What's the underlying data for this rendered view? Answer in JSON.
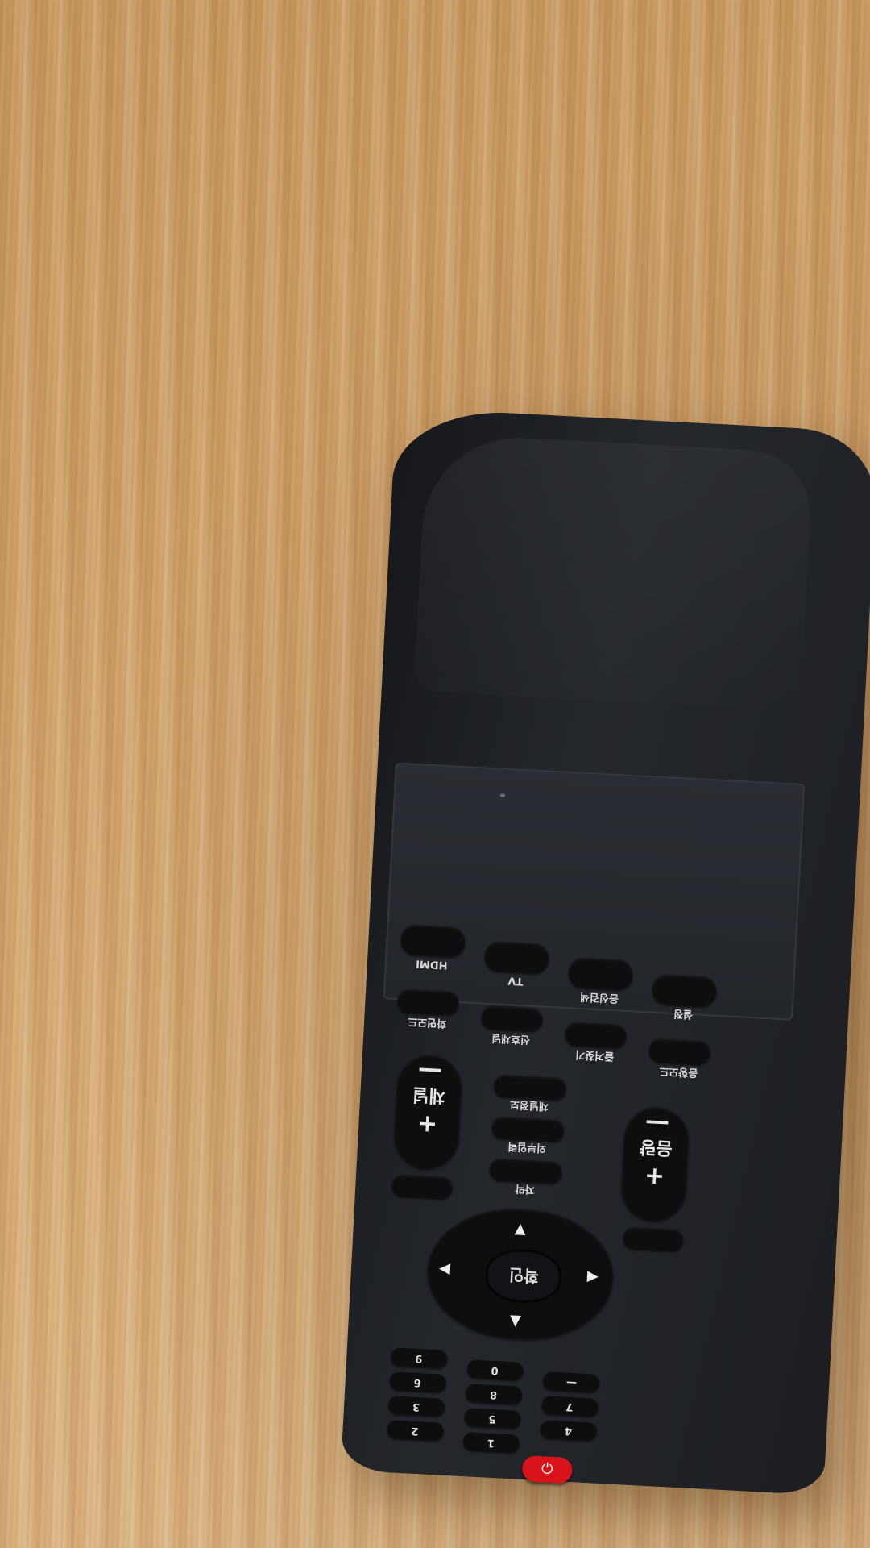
{
  "scene": {
    "surface": "light oak wood tabletop",
    "object": "black TV remote control, upside down"
  },
  "remote": {
    "source_buttons": [
      "HDMI",
      "TV",
      "음성검색",
      "설정"
    ],
    "row2": [
      "화면모드",
      "선호채널",
      "즐겨찾기",
      "음향모드"
    ],
    "channel_label": "채널",
    "volume_label": "음량",
    "middle_keys": [
      "채널정보",
      "외부입력",
      "자막"
    ],
    "ok_label": "확인",
    "minus": "—",
    "plus": "+",
    "up_arrow": "▲",
    "down_arrow": "▼",
    "left_arrow": "◀",
    "right_arrow": "▶",
    "numbers": [
      "1",
      "2",
      "3",
      "4",
      "5",
      "6",
      "7",
      "8",
      "9",
      "0"
    ],
    "power_icon": "⏻"
  }
}
